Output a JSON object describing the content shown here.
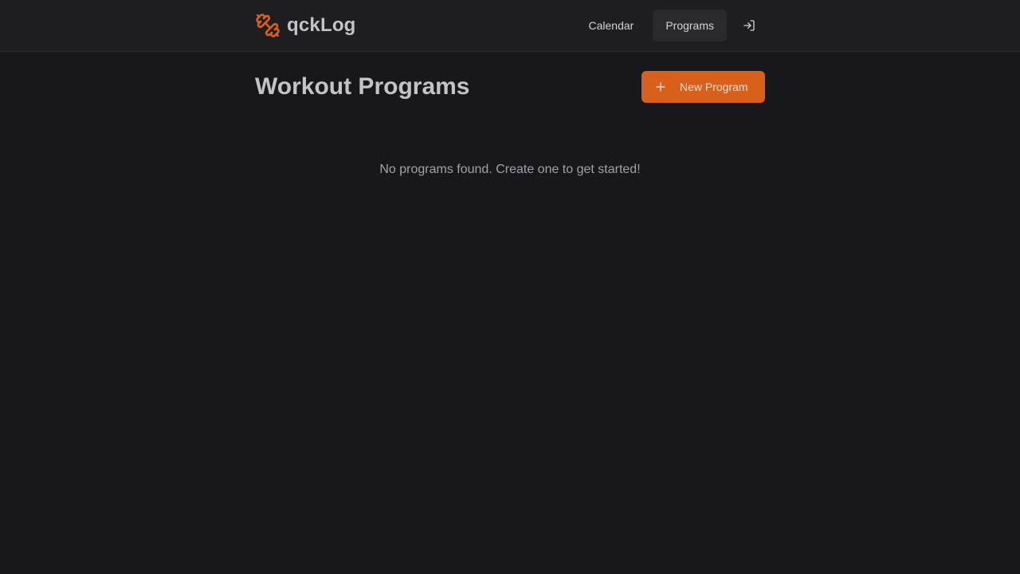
{
  "app": {
    "name": "qckLog",
    "logo_icon": "dumbbell-icon",
    "accent_color": "#d9601a"
  },
  "nav": {
    "items": [
      {
        "label": "Calendar",
        "active": false
      },
      {
        "label": "Programs",
        "active": true
      }
    ],
    "login_icon": "log-in-icon"
  },
  "main": {
    "title": "Workout Programs",
    "new_button": {
      "label": "New Program",
      "icon": "plus-icon"
    },
    "empty_message": "No programs found. Create one to get started!"
  }
}
